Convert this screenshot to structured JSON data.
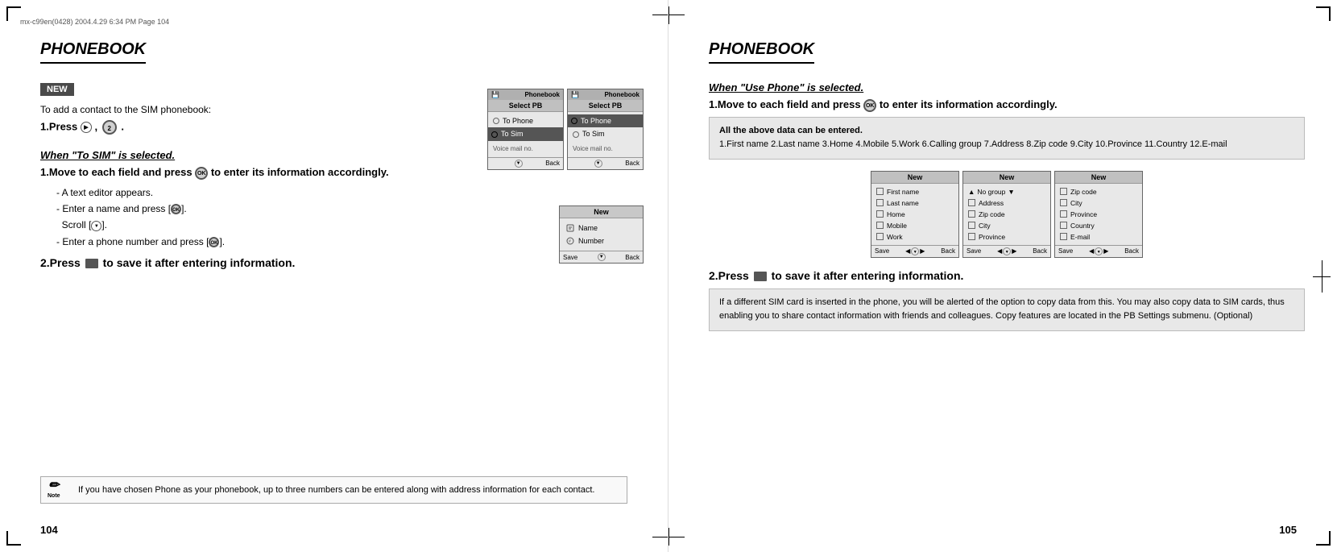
{
  "header": {
    "text": "mx-c99en(0428)   2004.4.29   6:34 PM   Page 104"
  },
  "left_page": {
    "title": "PHONEBOOK",
    "new_badge": "NEW",
    "intro": "To add a contact to the SIM phonebook:",
    "step1_label": "1.Press",
    "step1_suffix": ",",
    "when_to_sim": {
      "heading": "When \"To SIM\" is selected.",
      "step": "1.Move to each field and press",
      "step_suffix": "to enter its information accordingly.",
      "bullets": [
        "A text editor appears.",
        "Enter a name and press [    ].",
        "Scroll [    ].",
        "Enter a phone number and press [    ]."
      ]
    },
    "step2": "2.Press       to save it after entering information.",
    "phone_screens": {
      "screen1": {
        "header_left": "Phonebook",
        "header_right": "",
        "title": "Select PB",
        "row1": "To Phone",
        "row2": "To Sim",
        "voicemail": "Voice mail no.",
        "footer_right": "Back"
      },
      "screen2": {
        "header_left": "Phonebook",
        "header_right": "",
        "title": "Select PB",
        "row1": "To Phone",
        "row2": "To Sim",
        "voicemail": "Voice mail no.",
        "footer_right": "Back"
      }
    },
    "new_screen": {
      "title": "New",
      "row1": "Name",
      "row2": "Number",
      "footer_left": "Save",
      "footer_right": "Back"
    },
    "note": {
      "icon": "Note",
      "text": "If you have chosen Phone as your phonebook, up to three numbers can be entered along with address information for each contact."
    },
    "page_number": "104"
  },
  "right_page": {
    "title": "PHONEBOOK",
    "when_use_phone": {
      "heading": "When \"Use Phone\" is selected.",
      "step1": "1.Move to each field and press",
      "step1_ok": "OK",
      "step1_suffix": "to enter its information accordingly."
    },
    "info_box": {
      "heading": "All the above data can be entered.",
      "items": "1.First name 2.Last name 3.Home 4.Mobile 5.Work 6.Calling group 7.Address 8.Zip code 9.City 10.Province 11.Country 12.E-mail"
    },
    "phone_screens": {
      "screen1": {
        "title": "New",
        "rows": [
          "First name",
          "Last name",
          "Home",
          "Mobile",
          "Work"
        ],
        "footer_left": "Save",
        "footer_right": "Back"
      },
      "screen2": {
        "title": "New",
        "rows_header": "No group",
        "rows": [
          "Address",
          "Zip code",
          "City",
          "Province"
        ],
        "footer_left": "Save",
        "footer_right": "Back"
      },
      "screen3": {
        "title": "New",
        "rows": [
          "Zip code",
          "City",
          "Province",
          "Country",
          "E-mail"
        ],
        "footer_left": "Save",
        "footer_right": "Back"
      }
    },
    "step2": "2.Press       to save it after entering information.",
    "notif_box": {
      "text": "If a different SIM card is inserted in the phone, you will be alerted of the option to copy data from this. You may also copy data to SIM cards, thus enabling you to share contact information with friends and colleagues. Copy features are located in the PB Settings submenu. (Optional)"
    },
    "page_number": "105"
  }
}
